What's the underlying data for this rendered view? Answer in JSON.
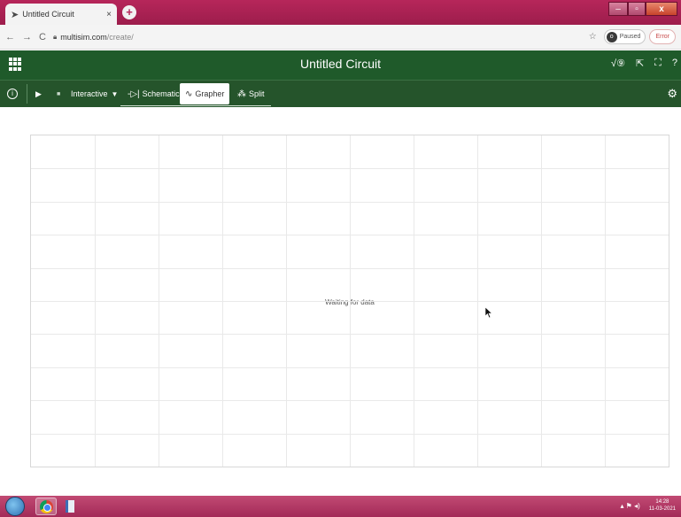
{
  "browser": {
    "tab_title": "Untitled Circuit",
    "tab_close": "×",
    "new_tab": "+",
    "url_domain": "multisim.com",
    "url_path": "/create/",
    "profile_initial": "o",
    "paused_label": "Paused",
    "error_label": "Error"
  },
  "app": {
    "title": "Untitled Circuit"
  },
  "toolbar": {
    "mode_label": "Interactive",
    "tabs": [
      {
        "label": "Schematic",
        "icon": "schematic-icon"
      },
      {
        "label": "Grapher",
        "icon": "grapher-icon",
        "active": true
      },
      {
        "label": "Split",
        "icon": "split-icon"
      }
    ]
  },
  "grapher": {
    "status_text": "Waiting for data"
  },
  "taskbar": {
    "time": "14:28",
    "date": "11-03-2021"
  },
  "colors": {
    "titlebar": "#b6265a",
    "app_header": "#1f5a2a",
    "toolbar": "#25542b",
    "taskbar": "#a32a58"
  }
}
